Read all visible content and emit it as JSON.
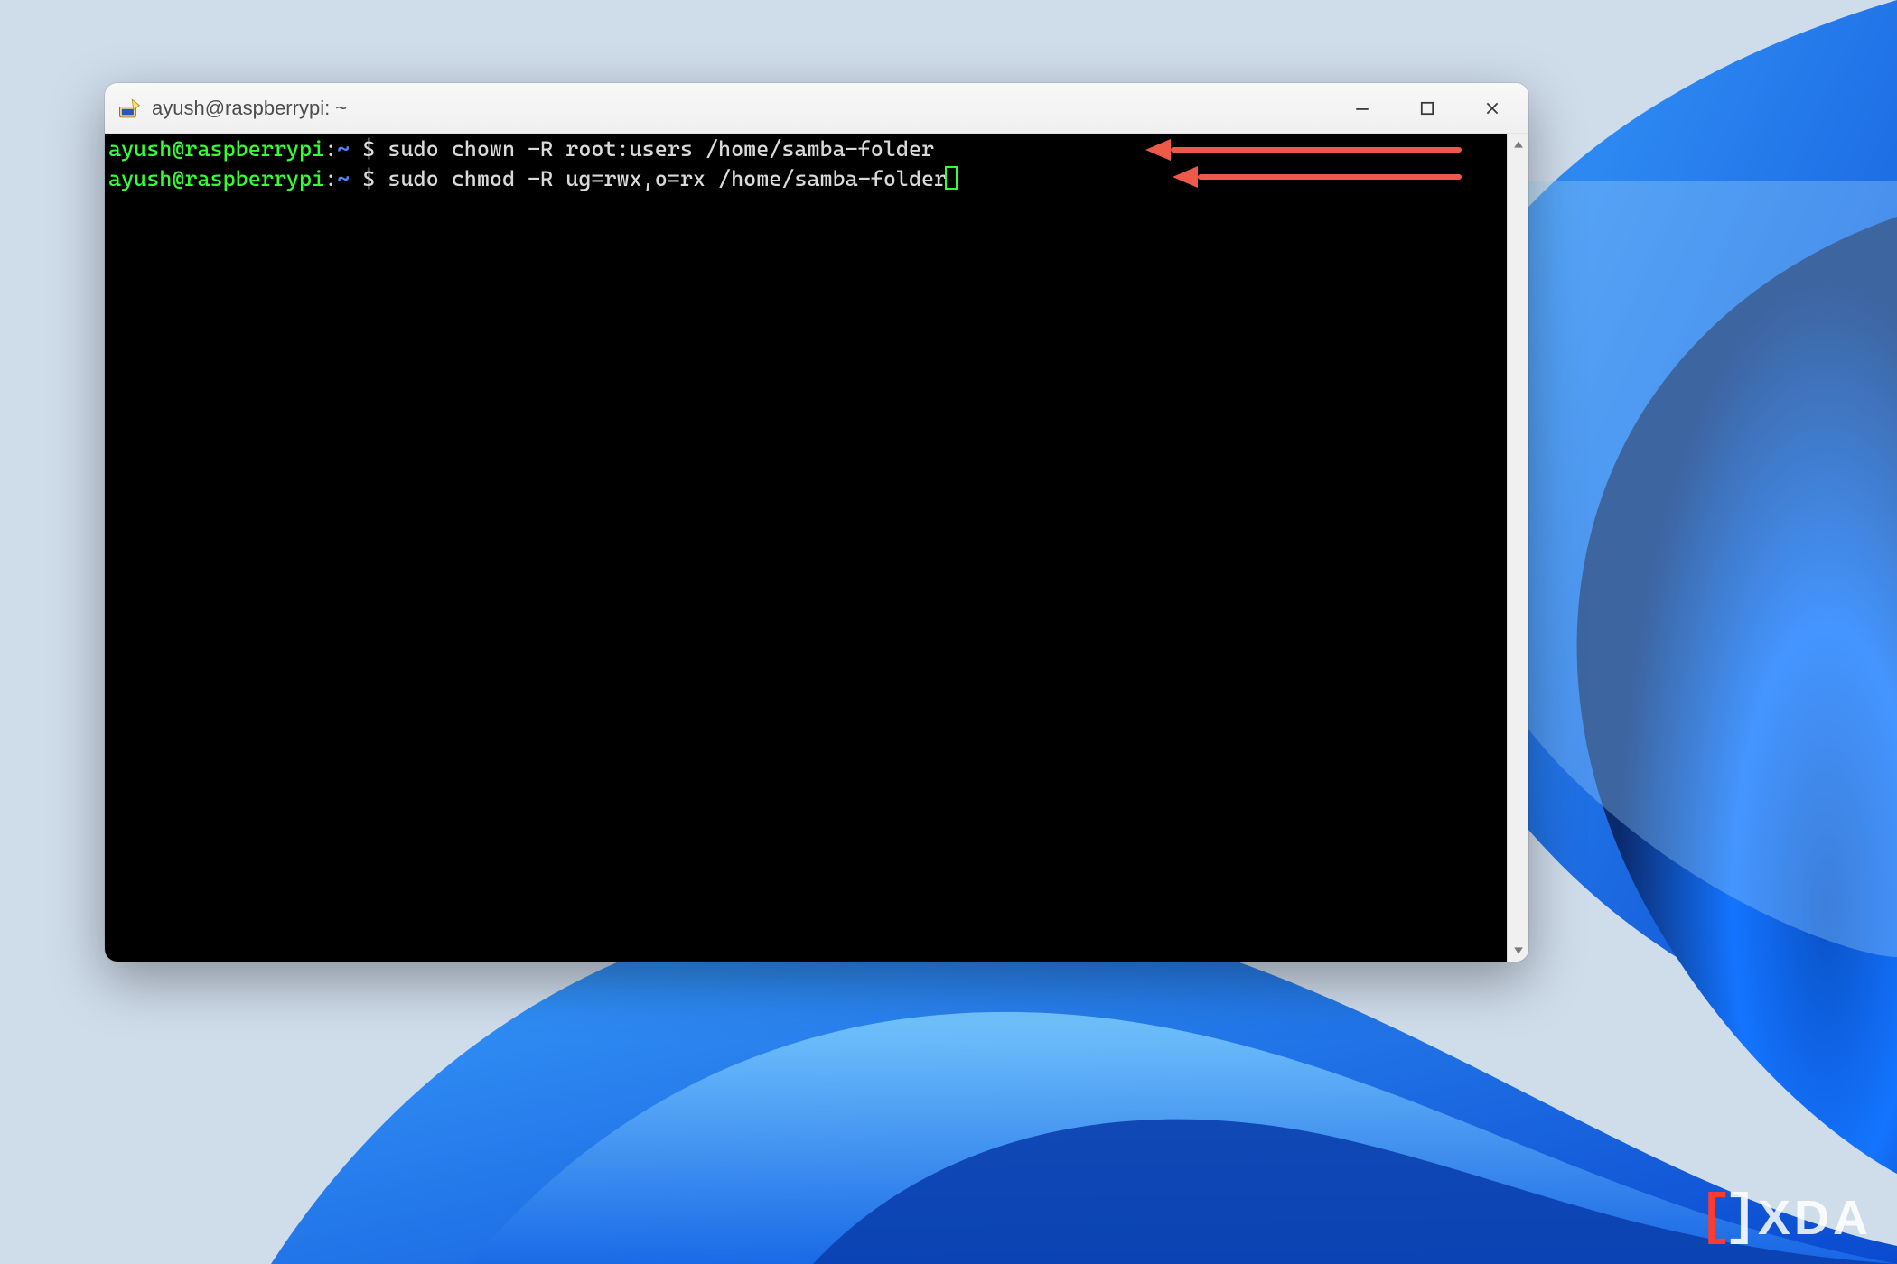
{
  "colors": {
    "term_bg": "#000000",
    "prompt_user": "#33ff33",
    "prompt_path": "#4f86ff",
    "command_text": "#d9d9d9",
    "annotation_arrow": "#ee5a4a"
  },
  "window": {
    "title": "ayush@raspberrypi: ~"
  },
  "terminal": {
    "prompt": {
      "user": "ayush",
      "host": "raspberrypi",
      "path": "~",
      "symbol": "$"
    },
    "lines": [
      {
        "command": "sudo chown -R root:users /home/samba-folder",
        "has_cursor": false
      },
      {
        "command": "sudo chmod -R ug=rwx,o=rx /home/samba-folder",
        "has_cursor": true
      }
    ]
  },
  "watermark": {
    "text": "XDA"
  }
}
